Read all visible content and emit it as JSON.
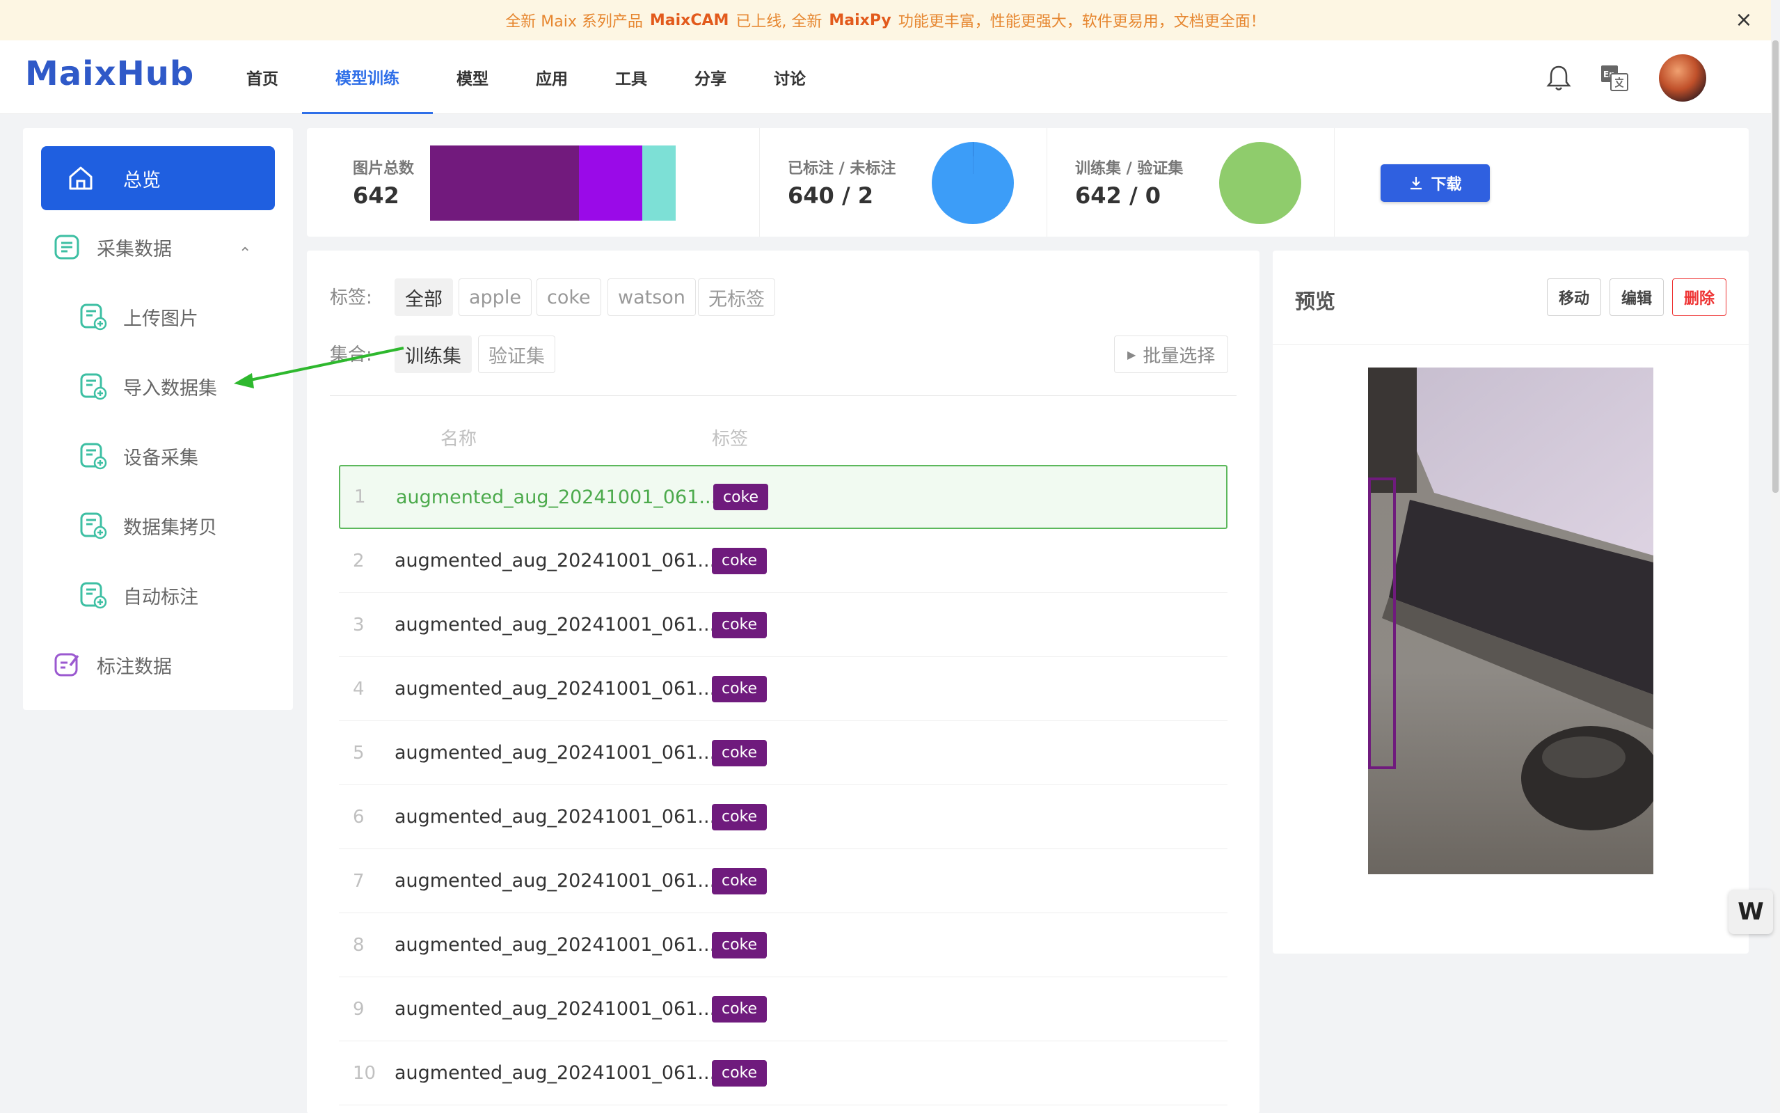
{
  "banner": {
    "part1": "全新 Maix 系列产品",
    "brand1": "MaixCAM",
    "part2": "已上线, 全新",
    "brand2": "MaixPy",
    "part3": "功能更丰富，性能更强大，软件更易用，文档更全面！",
    "close_icon": "close-icon"
  },
  "header": {
    "logo": "MaixHub",
    "nav": [
      "首页",
      "模型训练",
      "模型",
      "应用",
      "工具",
      "分享",
      "讨论"
    ],
    "active_nav": "模型训练"
  },
  "sidebar": {
    "overview": "总览",
    "collect_group": "采集数据",
    "sub_items": [
      "上传图片",
      "导入数据集",
      "设备采集",
      "数据集拷贝",
      "自动标注"
    ],
    "annotate": "标注数据"
  },
  "stats": {
    "total_label": "图片总数",
    "total_value": "642",
    "labeled_label": "已标注 / 未标注",
    "labeled_value": "640 / 2",
    "split_label": "训练集 / 验证集",
    "split_value": "642 / 0",
    "download": "下载",
    "colors": {
      "bar1": "#721a7d",
      "bar2": "#9a0ae8",
      "bar3": "#7de0d6",
      "pie_labeled": "#3c9df8",
      "pie_split": "#8fcc6c"
    },
    "bar_fractions": [
      0.607,
      0.257,
      0.136
    ]
  },
  "filters": {
    "tag_label": "标签:",
    "tags": [
      "全部",
      "apple",
      "coke",
      "watson",
      "无标签"
    ],
    "set_label": "集合:",
    "sets": [
      "训练集",
      "验证集"
    ],
    "batch": "批量选择"
  },
  "table": {
    "headers": [
      "名称",
      "标签"
    ],
    "rows": [
      {
        "num": "1",
        "name": "augmented_aug_20241001_061...",
        "tag": "coke"
      },
      {
        "num": "2",
        "name": "augmented_aug_20241001_061...",
        "tag": "coke"
      },
      {
        "num": "3",
        "name": "augmented_aug_20241001_061...",
        "tag": "coke"
      },
      {
        "num": "4",
        "name": "augmented_aug_20241001_061...",
        "tag": "coke"
      },
      {
        "num": "5",
        "name": "augmented_aug_20241001_061...",
        "tag": "coke"
      },
      {
        "num": "6",
        "name": "augmented_aug_20241001_061...",
        "tag": "coke"
      },
      {
        "num": "7",
        "name": "augmented_aug_20241001_061...",
        "tag": "coke"
      },
      {
        "num": "8",
        "name": "augmented_aug_20241001_061...",
        "tag": "coke"
      },
      {
        "num": "9",
        "name": "augmented_aug_20241001_061...",
        "tag": "coke"
      },
      {
        "num": "10",
        "name": "augmented_aug_20241001_061...",
        "tag": "coke"
      }
    ]
  },
  "preview": {
    "title": "预览",
    "move": "移动",
    "edit": "编辑",
    "delete": "删除"
  },
  "float_button": "W"
}
